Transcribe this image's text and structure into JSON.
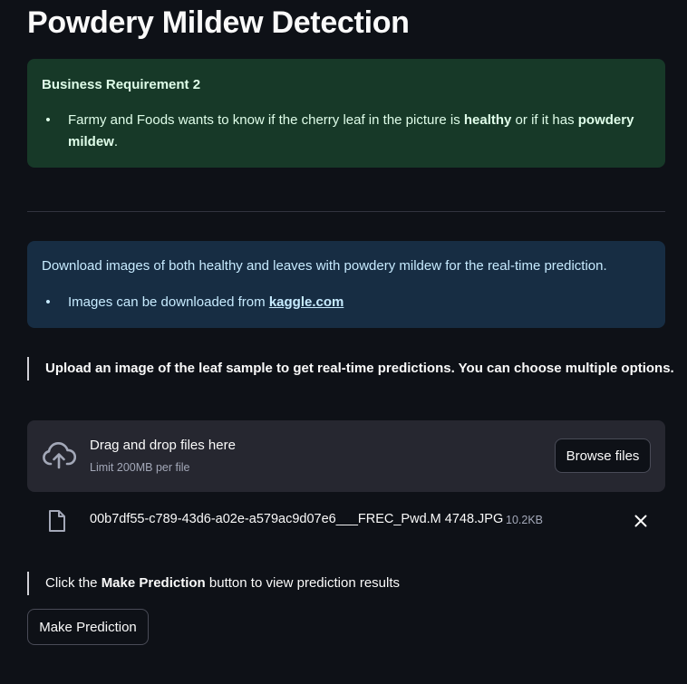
{
  "page": {
    "title": "Powdery Mildew Detection"
  },
  "business_requirement": {
    "title": "Business Requirement 2",
    "bullet_text_1": "Farmy and Foods wants to know if the cherry leaf in the picture is ",
    "bullet_bold_1": "healthy",
    "bullet_text_2": " or if it has ",
    "bullet_bold_2": "powdery mildew",
    "bullet_text_3": "."
  },
  "info": {
    "text": "Download images of both healthy and leaves with powdery mildew for the real-time prediction.",
    "bullet_text": "Images can be downloaded from ",
    "link_text": "kaggle.com"
  },
  "upload_instruction": "Upload an image of the leaf sample to get real-time predictions. You can choose multiple options.",
  "uploader": {
    "drop_label": "Drag and drop files here",
    "limit_label": "Limit 200MB per file",
    "browse_label": "Browse files",
    "icon": "cloud-upload-icon"
  },
  "uploaded_file": {
    "name": "00b7df55-c789-43d6-a02e-a579ac9d07e6___FREC_Pwd.M 4748.JPG",
    "size": "10.2KB",
    "icon": "file-icon",
    "remove_icon": "close-icon"
  },
  "prediction_hint": {
    "text_before": "Click the ",
    "bold": "Make Prediction",
    "text_after": " button to view prediction results"
  },
  "predict_button": {
    "label": "Make Prediction"
  },
  "colors": {
    "background": "#0e1117",
    "success_bg": "#173928",
    "success_text": "#dffde9",
    "info_bg": "#172d43",
    "info_text": "#c7ebff",
    "uploader_bg": "#262730"
  }
}
